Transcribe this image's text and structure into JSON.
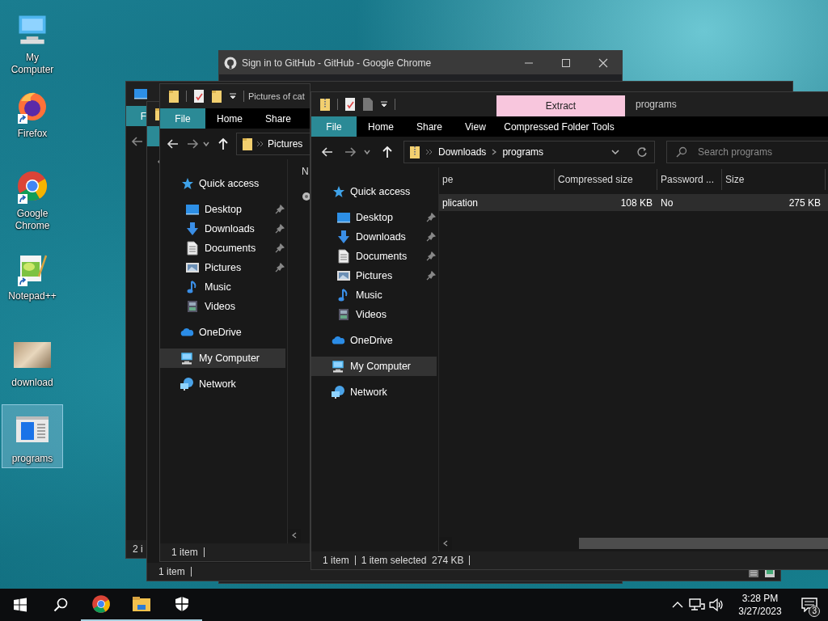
{
  "desktop_icons": [
    {
      "label": "My Computer",
      "kind": "computer",
      "shortcut": false,
      "selected": false
    },
    {
      "label": "Firefox",
      "kind": "firefox",
      "shortcut": true,
      "selected": false
    },
    {
      "label": "Google Chrome",
      "kind": "chrome",
      "shortcut": true,
      "selected": false
    },
    {
      "label": "Notepad++",
      "kind": "notepad",
      "shortcut": true,
      "selected": false
    },
    {
      "label": "download",
      "kind": "photo",
      "shortcut": false,
      "selected": false
    },
    {
      "label": "programs",
      "kind": "zip",
      "shortcut": false,
      "selected": true
    }
  ],
  "windows": [
    {
      "kind": "browser",
      "title": "Sign in to GitHub - GitHub - Google Chrome"
    },
    {
      "kind": "stub",
      "file_tab": "F",
      "status": [
        "2 i"
      ]
    },
    {
      "kind": "stub",
      "status": [
        "1 item"
      ]
    },
    {
      "kind": "explorer",
      "title": "Pictures of cat",
      "file_tab": "File",
      "tabs": [
        "Home",
        "Share"
      ],
      "address": [
        "Pictures"
      ],
      "columns": [
        "N"
      ],
      "rows": [
        {
          "cells": [],
          "selected": false
        }
      ],
      "sidebar": [
        {
          "label": "Quick access",
          "kind": "star",
          "selected": false,
          "children": [
            {
              "label": "Desktop",
              "kind": "desktop",
              "pinned": true,
              "selected": false
            },
            {
              "label": "Downloads",
              "kind": "download",
              "pinned": true,
              "selected": false
            },
            {
              "label": "Documents",
              "kind": "document",
              "pinned": true,
              "selected": false
            },
            {
              "label": "Pictures",
              "kind": "pictures",
              "pinned": true,
              "selected": false
            },
            {
              "label": "Music",
              "kind": "music",
              "pinned": false,
              "selected": false
            },
            {
              "label": "Videos",
              "kind": "video",
              "pinned": false,
              "selected": false
            }
          ]
        },
        {
          "label": "OneDrive",
          "kind": "cloud",
          "selected": false
        },
        {
          "label": "My Computer",
          "kind": "computer",
          "selected": true
        },
        {
          "label": "Network",
          "kind": "network",
          "selected": false
        }
      ],
      "status": [
        "1 item"
      ]
    },
    {
      "kind": "explorer",
      "title": "programs",
      "context_tab": {
        "group": "Extract",
        "label": "Compressed Folder Tools"
      },
      "file_tab": "File",
      "tabs": [
        "Home",
        "Share",
        "View"
      ],
      "address": [
        "Downloads",
        "programs"
      ],
      "search": {
        "placeholder": "Search programs"
      },
      "columns": [
        "pe",
        "Compressed size",
        "Password ...",
        "Size"
      ],
      "rows": [
        {
          "cells": [
            "plication",
            "108 KB",
            "No",
            "275 KB"
          ],
          "selected": true
        }
      ],
      "sidebar": [
        {
          "label": "Quick access",
          "kind": "star",
          "selected": false,
          "children": [
            {
              "label": "Desktop",
              "kind": "desktop",
              "pinned": true,
              "selected": false
            },
            {
              "label": "Downloads",
              "kind": "download",
              "pinned": true,
              "selected": false
            },
            {
              "label": "Documents",
              "kind": "document",
              "pinned": true,
              "selected": false
            },
            {
              "label": "Pictures",
              "kind": "pictures",
              "pinned": true,
              "selected": false
            },
            {
              "label": "Music",
              "kind": "music",
              "pinned": false,
              "selected": false
            },
            {
              "label": "Videos",
              "kind": "video",
              "pinned": false,
              "selected": false
            }
          ]
        },
        {
          "label": "OneDrive",
          "kind": "cloud",
          "selected": false
        },
        {
          "label": "My Computer",
          "kind": "computer",
          "selected": true
        },
        {
          "label": "Network",
          "kind": "network",
          "selected": false
        }
      ],
      "status": [
        "1 item",
        "1 item selected  274 KB"
      ]
    }
  ],
  "taskbar": {
    "apps": [
      {
        "kind": "chrome",
        "running": true
      },
      {
        "kind": "explorer",
        "running": true
      },
      {
        "kind": "shield",
        "running": true
      }
    ],
    "clock": {
      "time": "3:28 PM",
      "date": "3/27/2023"
    },
    "notifications": "3"
  }
}
